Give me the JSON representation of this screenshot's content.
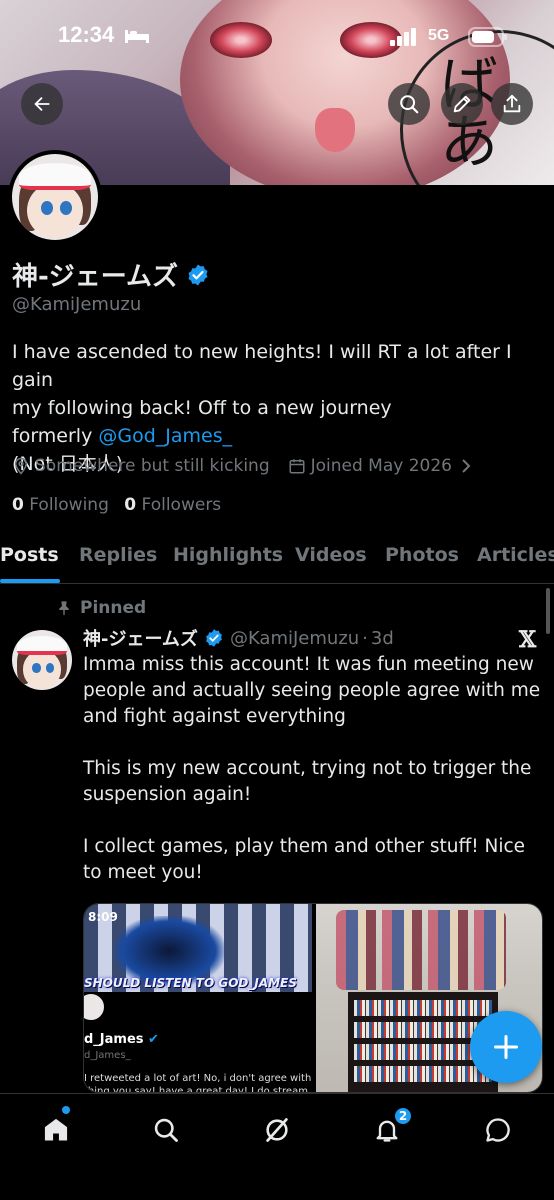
{
  "status_bar": {
    "time": "12:34",
    "network": "5G"
  },
  "profile": {
    "display_name": "神-ジェームズ",
    "handle": "@KamiJemuzu",
    "bio_line1": "I have ascended to new heights! I will RT a lot after I gain",
    "bio_line2": "my following back! Off to a new journey",
    "bio_line3_prefix": "formerly ",
    "bio_line3_link": "@God_James_",
    "bio_line4": "(Not 日本人)",
    "location": "Somewhere but still kicking",
    "joined": "Joined May 2026",
    "following_count": "0",
    "following_label": "Following",
    "followers_count": "0",
    "followers_label": "Followers",
    "banner_text": "ばあ"
  },
  "tabs": [
    {
      "label": "Posts",
      "active": true
    },
    {
      "label": "Replies"
    },
    {
      "label": "Highlights"
    },
    {
      "label": "Videos"
    },
    {
      "label": "Photos"
    },
    {
      "label": "Articles"
    }
  ],
  "post": {
    "pinned_label": "Pinned",
    "author_name": "神-ジェームズ",
    "author_handle": "@KamiJemuzu",
    "separator": "·",
    "age": "3d",
    "para1": "Imma miss this account! It was fun meeting new people and actually seeing people agree with me and fight against everything",
    "para2": "This is my new account, trying not to trigger the suspension again!",
    "para3": "I collect games, play them and other stuff! Nice to meet you!",
    "media_left": {
      "time": "8:09",
      "banner": "SHOULD LISTEN TO GOD_JAMES",
      "name": "d_James",
      "handle": "d_James_",
      "bio_line1": "I retweeted a lot of art! No, i don't agree with",
      "bio_line2": "thing you say! have a great day! I do stream but"
    }
  },
  "notifications_badge": "2",
  "colors": {
    "accent": "#1d9bf0",
    "background": "#000000",
    "muted": "#71767b",
    "text": "#e7e9ea"
  },
  "icons": {
    "back": "arrow-left-icon",
    "search": "search-icon",
    "edit": "pencil-icon",
    "share": "share-icon",
    "verified": "verified-badge-icon",
    "location": "location-pin-icon",
    "calendar": "calendar-icon",
    "pin": "pin-icon",
    "x": "x-logo-icon",
    "compose": "plus-icon",
    "nav": [
      "home-icon",
      "search-icon",
      "grok-icon",
      "bell-icon",
      "messages-icon"
    ]
  }
}
